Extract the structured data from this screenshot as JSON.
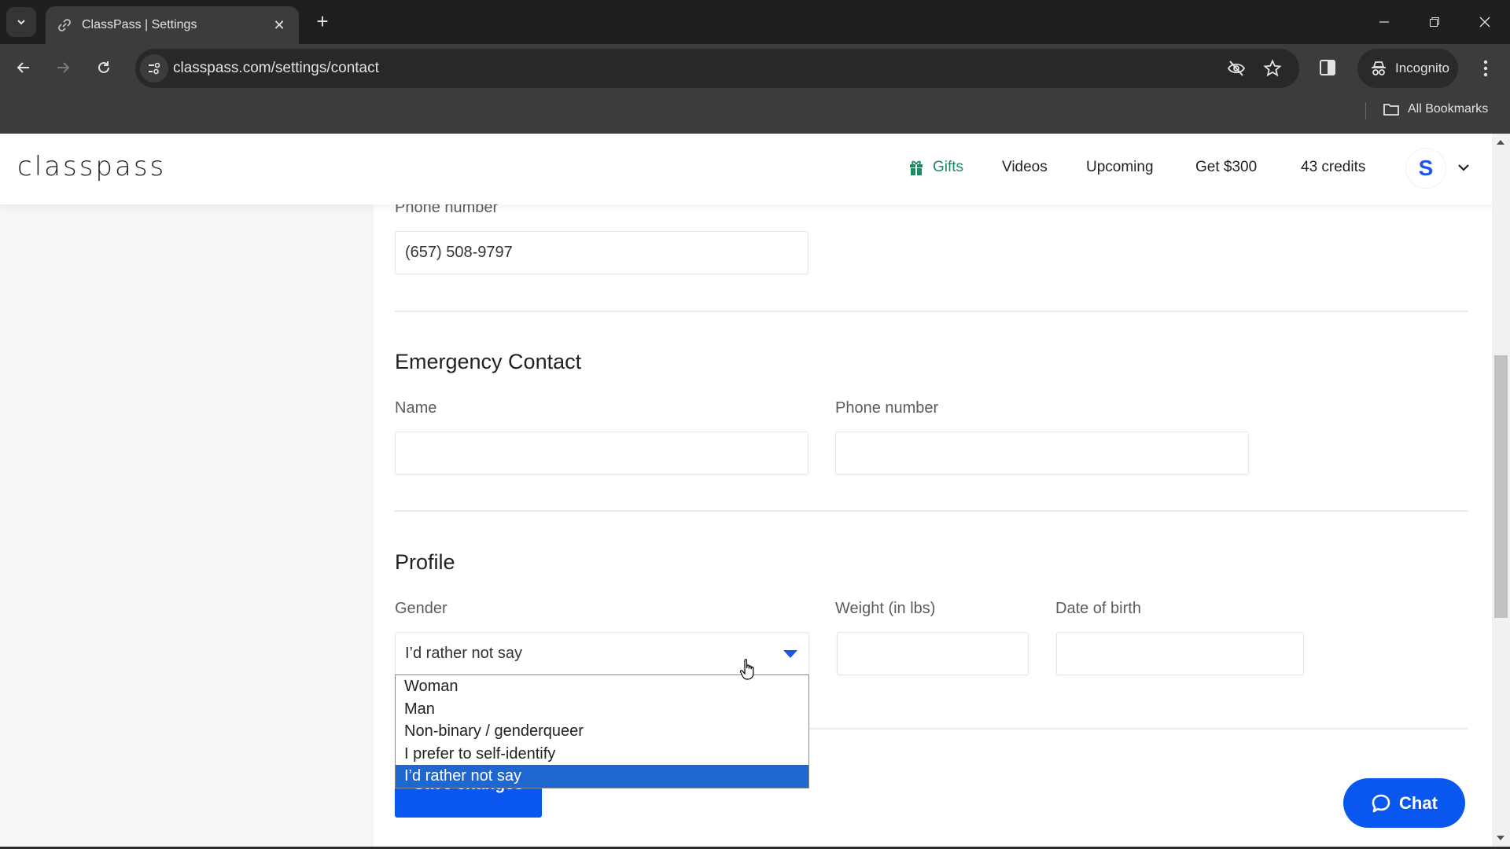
{
  "browser": {
    "tab_title": "ClassPass | Settings",
    "url": "classpass.com/settings/contact",
    "incognito_label": "Incognito",
    "bookmarks_label": "All Bookmarks"
  },
  "header": {
    "logo": "classpass",
    "nav": {
      "gifts": "Gifts",
      "videos": "Videos",
      "upcoming": "Upcoming",
      "referral": "Get $300",
      "credits": "43 credits"
    },
    "avatar_initial": "S"
  },
  "contact": {
    "phone_label": "Phone number",
    "phone_value": "(657) 508-9797"
  },
  "emergency": {
    "title": "Emergency Contact",
    "name_label": "Name",
    "name_value": "",
    "phone_label": "Phone number",
    "phone_value": ""
  },
  "profile": {
    "title": "Profile",
    "gender_label": "Gender",
    "gender_value": "I’d rather not say",
    "gender_options": [
      "Woman",
      "Man",
      "Non-binary / genderqueer",
      "I prefer to self-identify",
      "I’d rather not say"
    ],
    "weight_label": "Weight (in lbs)",
    "weight_value": "",
    "dob_label": "Date of birth",
    "dob_value": ""
  },
  "actions": {
    "save_label": "Save changes",
    "chat_label": "Chat"
  },
  "colors": {
    "brand_blue": "#0a57f0",
    "gifts_green": "#1a8b5f",
    "option_highlight": "#1e67d0"
  }
}
